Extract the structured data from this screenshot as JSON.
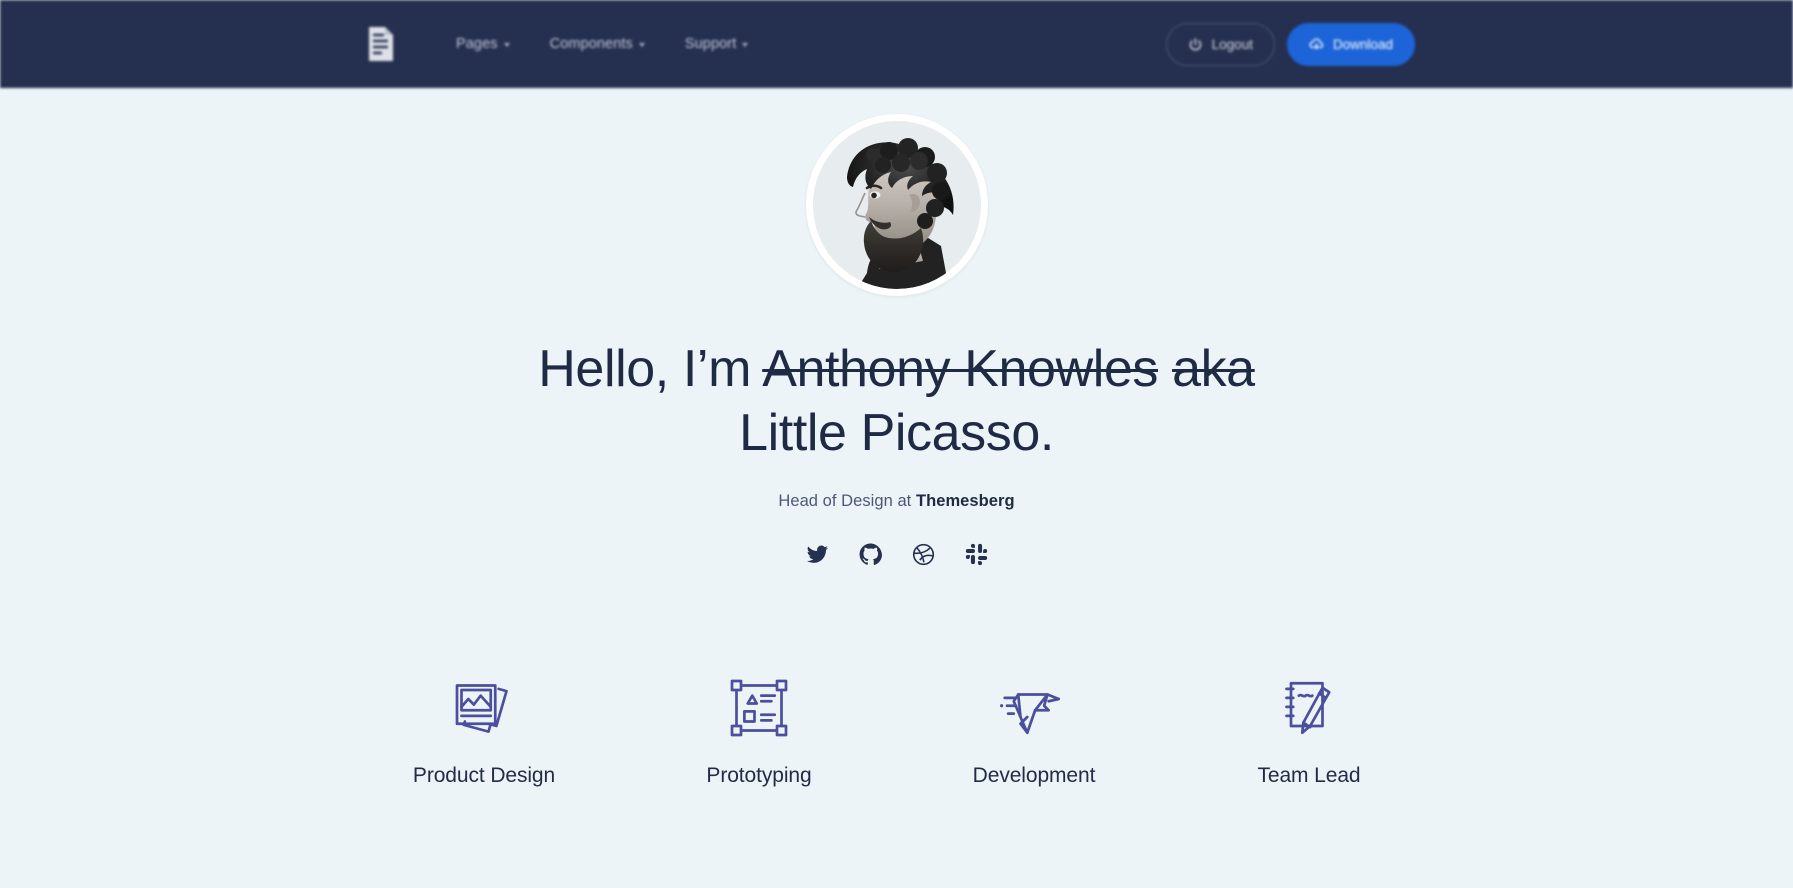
{
  "navbar": {
    "logo_name": "themesberg-logo",
    "links": [
      {
        "label": "Pages",
        "icon": "chevron-down-icon"
      },
      {
        "label": "Components",
        "icon": "chevron-down-icon"
      },
      {
        "label": "Support",
        "icon": "chevron-down-icon"
      }
    ],
    "logout_label": "Logout",
    "logout_icon": "power-icon",
    "download_label": "Download",
    "download_icon": "cloud-download-icon",
    "bg_color": "#252f4f",
    "primary_color": "#1c64d8"
  },
  "hero": {
    "avatar_alt": "Portrait photo of a bearded man with curly hair in profile",
    "greeting": "Hello, I’m",
    "name_struck": "Anthony Knowles",
    "aka_struck": "aka",
    "nickname": "Little Picasso.",
    "subtitle_prefix": "Head of Design at",
    "subtitle_brand": "Themesberg",
    "socials": [
      {
        "name": "twitter-icon",
        "label": "Twitter"
      },
      {
        "name": "github-icon",
        "label": "GitHub"
      },
      {
        "name": "dribbble-icon",
        "label": "Dribbble"
      },
      {
        "name": "slack-icon",
        "label": "Slack"
      }
    ],
    "bg_color": "#edf4f7",
    "text_color": "#1f2a44"
  },
  "skills": {
    "accent_color": "#4b4f9e",
    "items": [
      {
        "label": "Product Design",
        "icon": "photo-stack-icon"
      },
      {
        "label": "Prototyping",
        "icon": "artboard-wireframe-icon"
      },
      {
        "label": "Development",
        "icon": "origami-bird-icon"
      },
      {
        "label": "Team Lead",
        "icon": "notepad-pencil-icon"
      }
    ]
  }
}
